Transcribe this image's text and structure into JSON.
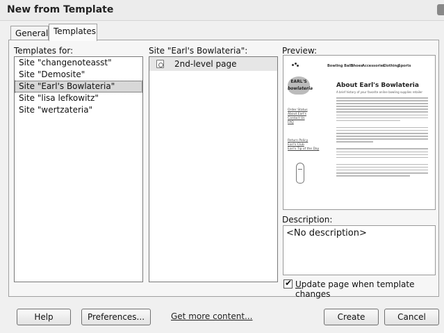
{
  "window": {
    "title": "New from Template"
  },
  "tabs": [
    {
      "label": "General",
      "active": false
    },
    {
      "label": "Templates",
      "active": true
    }
  ],
  "templates_for": {
    "label": "Templates for:",
    "items": [
      "Site \"changenoteasst\"",
      "Site \"Demosite\"",
      "Site \"Earl's Bowlateria\"",
      "Site \"lisa lefkowitz\"",
      "Site \"wertzateria\""
    ],
    "selected_index": 2
  },
  "site_templates": {
    "label": "Site \"Earl's Bowlateria\":",
    "items": [
      {
        "label": "2nd-level page",
        "icon": "template-page-icon"
      }
    ]
  },
  "preview": {
    "label": "Preview:",
    "thumbnail": {
      "nav": [
        "Bowling Balls",
        "Shoes",
        "Accessories",
        "Clothing",
        "Sports"
      ],
      "logo_lines": [
        "EARL'S",
        "bowlateria"
      ],
      "heading": "About Earl's Bowlateria",
      "subheading": "A brief history of your favorite online bowling supplies retailer",
      "side_links_1": [
        "Order Status",
        "About Earl's",
        "Contact Us",
        "FAQ"
      ],
      "side_links_2": [
        "Return Policy",
        "Earl's Club",
        "Earl's Tip of the Day"
      ]
    }
  },
  "description": {
    "label": "Description:",
    "value": "<No description>"
  },
  "update_checkbox": {
    "label": "Update page when template changes",
    "checked": true
  },
  "buttons": {
    "help": "Help",
    "preferences": "Preferences...",
    "get_more": "Get more content...",
    "create": "Create",
    "cancel": "Cancel"
  }
}
